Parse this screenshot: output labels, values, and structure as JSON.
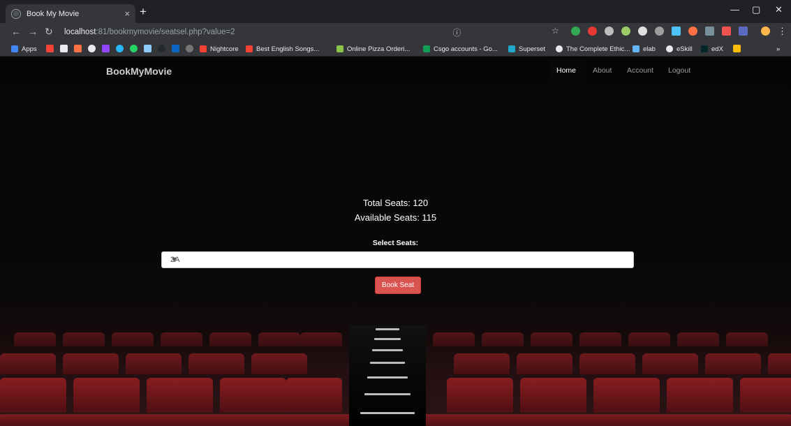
{
  "browser": {
    "tab_title": "Book My Movie",
    "url_host": "localhost",
    "url_path": ":81/bookmymovie/seatsel.php?value=2",
    "bookmarks": [
      "Apps",
      "Nightcore",
      "Best English Songs...",
      "Online Pizza Orderi...",
      "Csgo accounts - Go...",
      "Superset",
      "The Complete Ethic...",
      "elab",
      "eSkill",
      "edX"
    ]
  },
  "navbar": {
    "brand": "BookMyMovie",
    "links": [
      "Home",
      "About",
      "Account",
      "Logout"
    ]
  },
  "seats_info": {
    "total": "Total Seats: 120",
    "available": "Available Seats: 115",
    "select_label": "Select Seats:",
    "selected_value": "2A",
    "book_button": "Book Seat"
  },
  "colors": {
    "accent": "#d9534f",
    "seat": "#7a1a1e",
    "chrome": "#35363a"
  }
}
